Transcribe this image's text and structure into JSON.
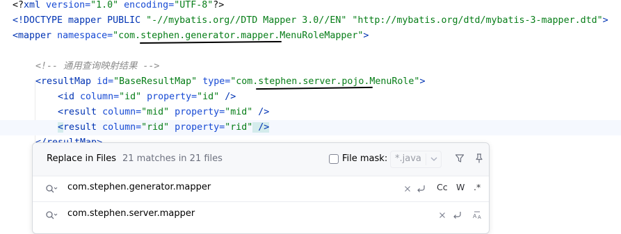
{
  "editor": {
    "lines": {
      "l1": {
        "a": "<?",
        "b": "xml",
        "c": " version=",
        "d": "\"1.0\"",
        "e": " encoding=",
        "f": "\"UTF-8\"",
        "g": "?>"
      },
      "l2": {
        "a": "<!DOCTYPE mapper PUBLIC ",
        "b": "\"-//mybatis.org//DTD Mapper 3.0//EN\"",
        "c": " ",
        "d": "\"http://mybatis.org/dtd/mybatis-3-mapper.dtd\"",
        "e": ">"
      },
      "l3": {
        "a": "<",
        "b": "mapper",
        "c": " namespace=",
        "d": "\"com.stephen.generator.mapper.MenuRoleMapper\"",
        "e": ">"
      },
      "l5": {
        "a": "<!-- 通用查询映射结果 -->"
      },
      "l6": {
        "a": "<",
        "b": "resultMap",
        "c": " id=",
        "d": "\"BaseResultMap\"",
        "e": " type=",
        "f": "\"com.stephen.server.pojo.MenuRole\"",
        "g": ">"
      },
      "l7": {
        "a": "<",
        "b": "id",
        "c": " column=",
        "d": "\"id\"",
        "e": " property=",
        "f": "\"id\"",
        "g": " />"
      },
      "l8": {
        "a": "<",
        "b": "result",
        "c": " column=",
        "d": "\"mid\"",
        "e": " property=",
        "f": "\"mid\"",
        "g": " />"
      },
      "l9": {
        "a": "<",
        "b": "result",
        "c": " column=",
        "d": "\"rid\"",
        "e": " property=",
        "f": "\"rid\"",
        "g": " />"
      },
      "l10": {
        "a": "</",
        "b": "resultMap",
        "c": ">"
      }
    }
  },
  "replace_panel": {
    "title": "Replace in Files",
    "match_count": "21 matches in 21 files",
    "file_mask_label": "File mask:",
    "file_mask_value": "*.java",
    "file_mask_checked": false,
    "search_value": "com.stephen.generator.mapper",
    "replace_value": "com.stephen.server.mapper",
    "options": {
      "match_case": "Cc",
      "words": "W",
      "regex": ".*"
    },
    "icons": {
      "filter": "filter-icon",
      "pin": "pin-icon",
      "search": "search-history-icon",
      "replace": "replace-history-icon",
      "clear": "clear-icon",
      "newline": "newline-icon",
      "preserve_case": "preserve-case-icon"
    }
  }
}
